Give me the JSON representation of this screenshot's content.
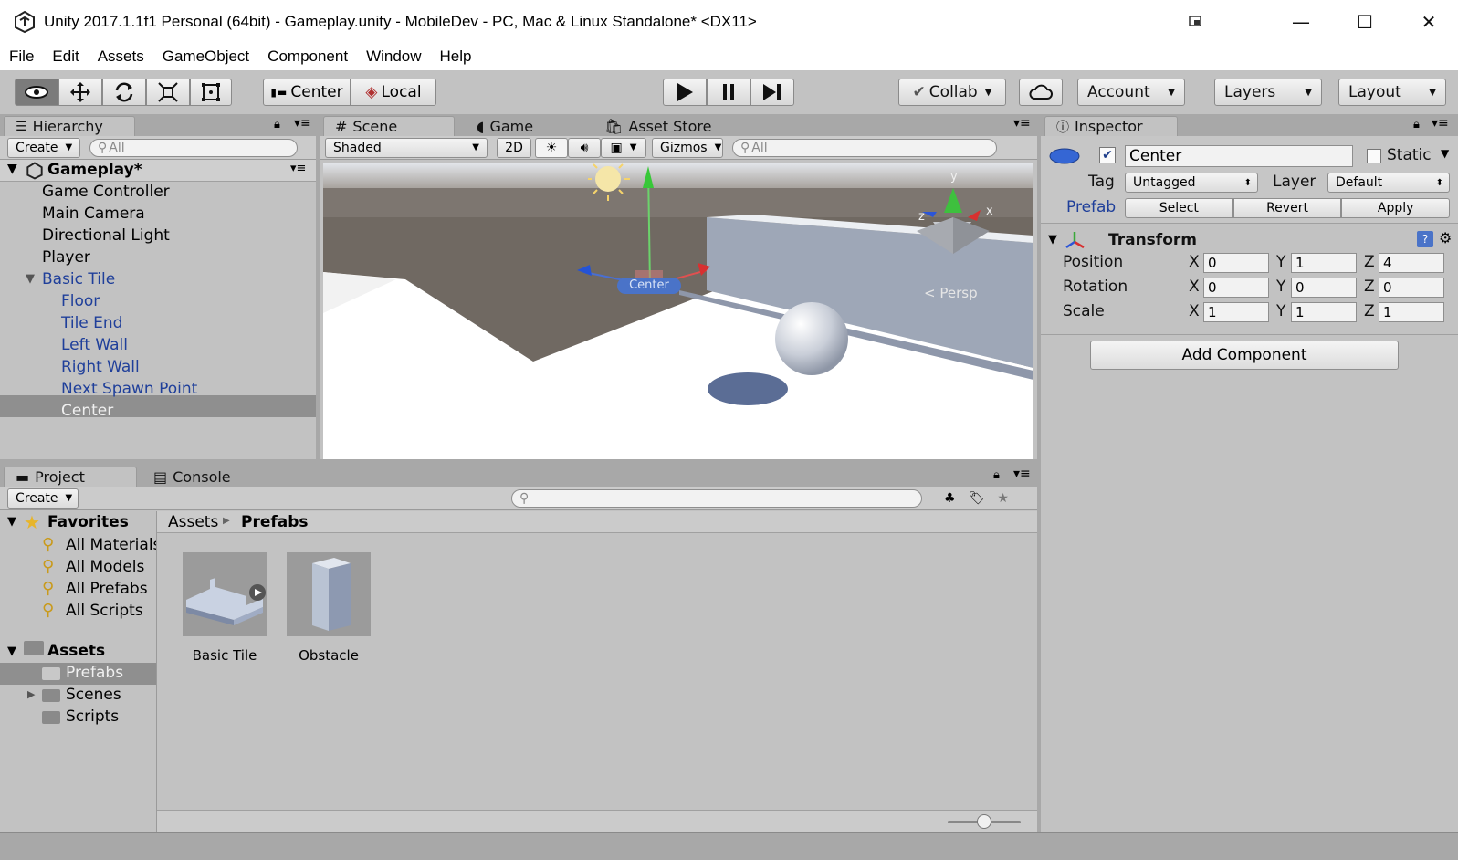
{
  "window": {
    "title": "Unity 2017.1.1f1 Personal (64bit) - Gameplay.unity - MobileDev - PC, Mac & Linux Standalone* <DX11>",
    "minimize_glyph": "—",
    "maximize_glyph": "☐",
    "close_glyph": "✕"
  },
  "menu": [
    "File",
    "Edit",
    "Assets",
    "GameObject",
    "Component",
    "Window",
    "Help"
  ],
  "toolbar": {
    "pivot_mode": "Center",
    "pivot_rotation": "Local",
    "collab": "Collab",
    "account": "Account",
    "layers": "Layers",
    "layout": "Layout"
  },
  "hierarchy": {
    "tab": "Hierarchy",
    "create": "Create",
    "search_placeholder": "All",
    "scene_name": "Gameplay*",
    "items": [
      {
        "label": "Game Controller",
        "indent": 1,
        "prefab": false
      },
      {
        "label": "Main Camera",
        "indent": 1,
        "prefab": false
      },
      {
        "label": "Directional Light",
        "indent": 1,
        "prefab": false
      },
      {
        "label": "Player",
        "indent": 1,
        "prefab": false
      },
      {
        "label": "Basic Tile",
        "indent": 1,
        "prefab": true,
        "expanded": true
      },
      {
        "label": "Floor",
        "indent": 2,
        "prefab": true
      },
      {
        "label": "Tile End",
        "indent": 2,
        "prefab": true
      },
      {
        "label": "Left Wall",
        "indent": 2,
        "prefab": true
      },
      {
        "label": "Right Wall",
        "indent": 2,
        "prefab": true
      },
      {
        "label": "Next Spawn Point",
        "indent": 2,
        "prefab": true
      },
      {
        "label": "Center",
        "indent": 2,
        "prefab": true,
        "selected": true
      }
    ]
  },
  "scene": {
    "tabs": [
      "Scene",
      "Game",
      "Asset Store"
    ],
    "shading": "Shaded",
    "mode_2d": "2D",
    "gizmos": "Gizmos",
    "search_placeholder": "All",
    "object_label": "Center",
    "projection": "Persp",
    "axis_y": "y",
    "axis_x": "x",
    "axis_z": "z"
  },
  "inspector": {
    "tab": "Inspector",
    "object_name": "Center",
    "active": true,
    "static_label": "Static",
    "tag_label": "Tag",
    "tag_value": "Untagged",
    "layer_label": "Layer",
    "layer_value": "Default",
    "prefab_label": "Prefab",
    "prefab_buttons": [
      "Select",
      "Revert",
      "Apply"
    ],
    "transform": {
      "title": "Transform",
      "rows": [
        {
          "label": "Position",
          "x": "0",
          "y": "1",
          "z": "4"
        },
        {
          "label": "Rotation",
          "x": "0",
          "y": "0",
          "z": "0"
        },
        {
          "label": "Scale",
          "x": "1",
          "y": "1",
          "z": "1"
        }
      ],
      "axis_labels": [
        "X",
        "Y",
        "Z"
      ]
    },
    "add_component": "Add Component"
  },
  "project": {
    "tabs": [
      "Project",
      "Console"
    ],
    "create": "Create",
    "favorites_title": "Favorites",
    "favorites": [
      "All Materials",
      "All Models",
      "All Prefabs",
      "All Scripts"
    ],
    "assets_title": "Assets",
    "folders": [
      {
        "label": "Prefabs",
        "selected": true,
        "expandable": false
      },
      {
        "label": "Scenes",
        "selected": false,
        "expandable": true
      },
      {
        "label": "Scripts",
        "selected": false,
        "expandable": false
      }
    ],
    "breadcrumb": [
      "Assets",
      "Prefabs"
    ],
    "assets": [
      {
        "label": "Basic Tile"
      },
      {
        "label": "Obstacle"
      }
    ]
  }
}
